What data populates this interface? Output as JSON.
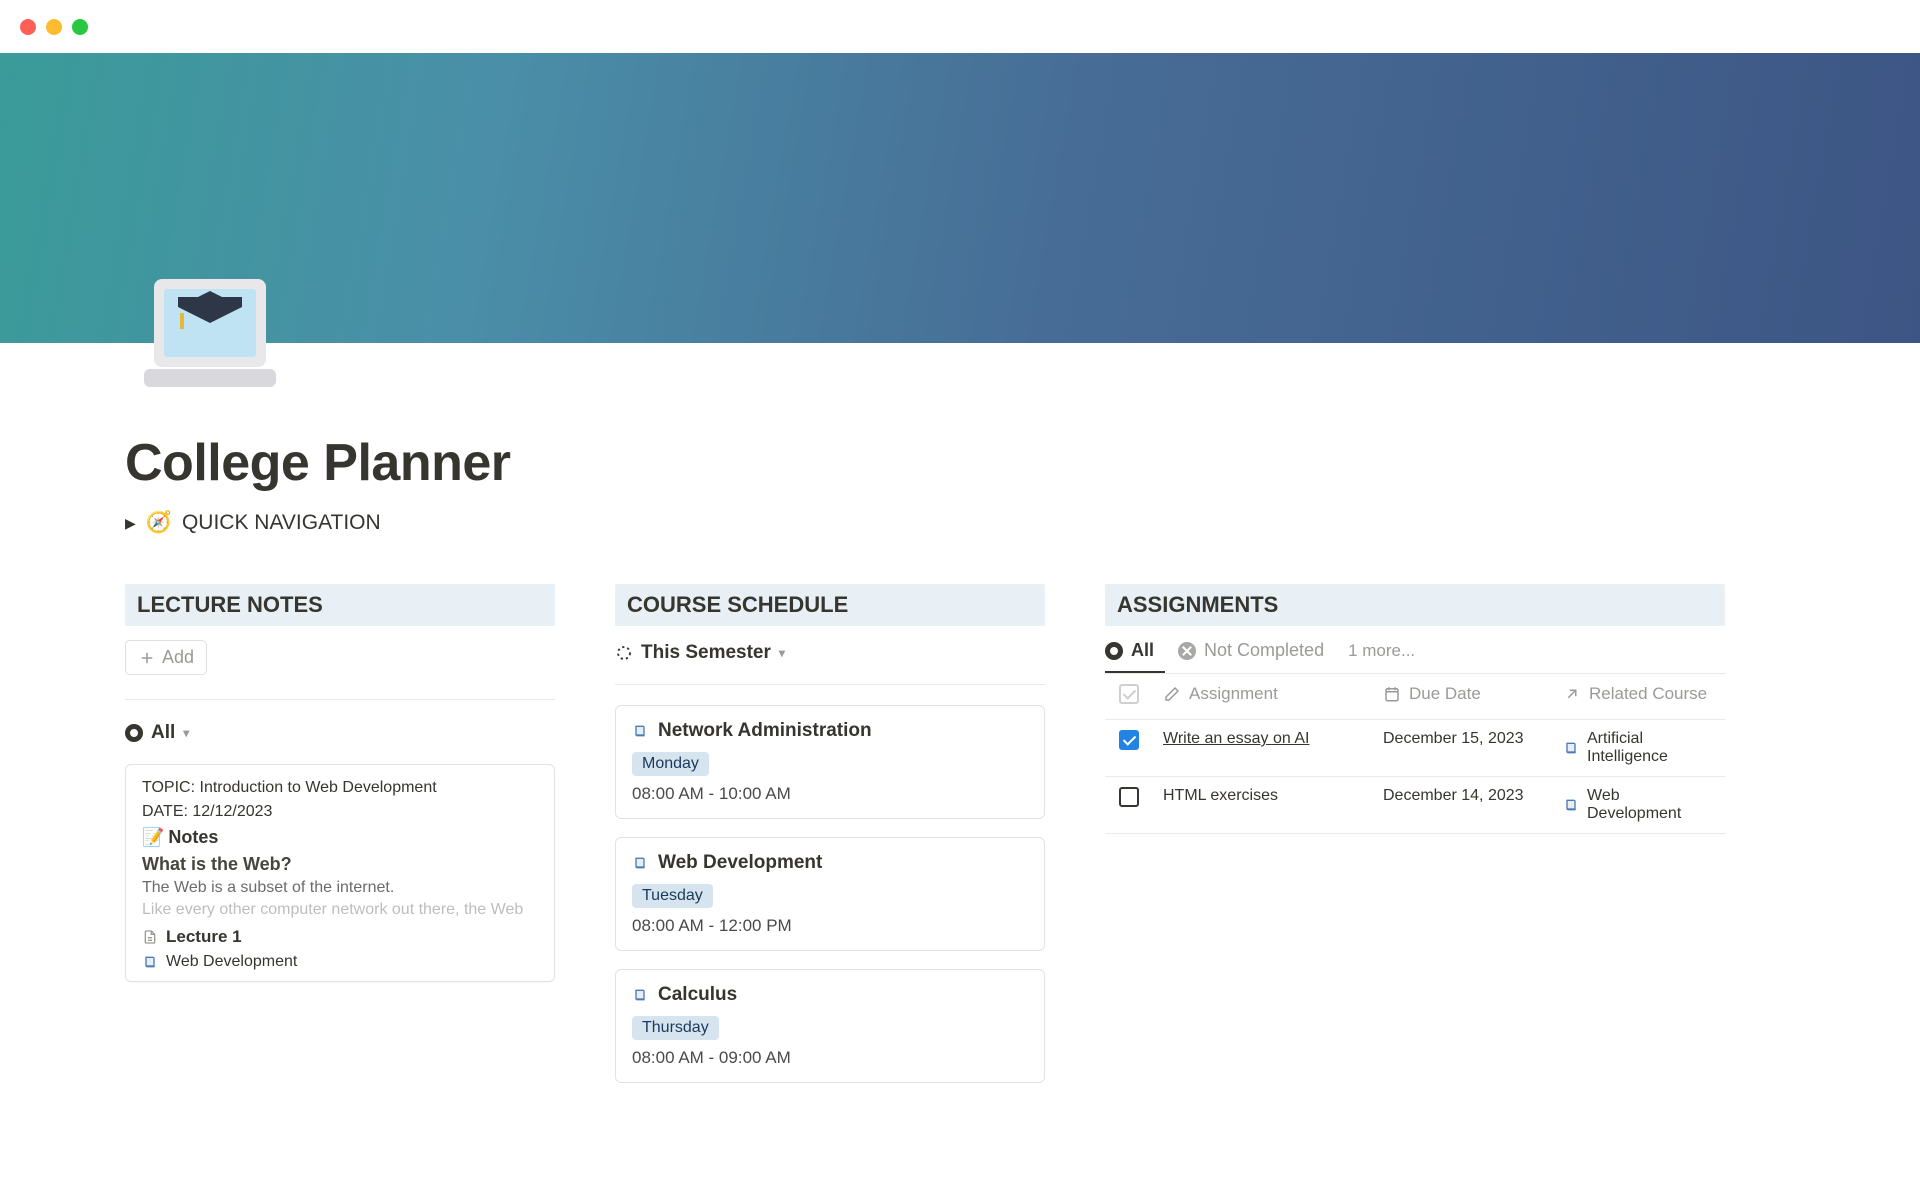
{
  "page": {
    "title": "College Planner"
  },
  "quicknav": {
    "icon": "🧭",
    "label": "QUICK NAVIGATION"
  },
  "sections": {
    "notes": "LECTURE NOTES",
    "schedule": "COURSE SCHEDULE",
    "assignments": "ASSIGNMENTS"
  },
  "notes": {
    "add": "Add",
    "view": "All",
    "card": {
      "topic": "TOPIC: Introduction to Web Development",
      "date": "DATE: 12/12/2023",
      "notes_hdr_icon": "📝",
      "notes_hdr": "Notes",
      "q": "What is the Web?",
      "l1": "The Web is a subset of the internet.",
      "l2": "Like every other computer network out there, the Web",
      "lecture": "Lecture 1",
      "tag": "Web Development"
    }
  },
  "schedule": {
    "view": "This Semester",
    "items": [
      {
        "title": "Network Administration",
        "day": "Monday",
        "time": "08:00 AM - 10:00 AM"
      },
      {
        "title": "Web Development",
        "day": "Tuesday",
        "time": "08:00 AM - 12:00 PM"
      },
      {
        "title": "Calculus",
        "day": "Thursday",
        "time": "08:00 AM - 09:00 AM"
      }
    ]
  },
  "assignments": {
    "tabs": {
      "all": "All",
      "nc": "Not Completed",
      "more": "1 more..."
    },
    "headers": {
      "assignment": "Assignment",
      "due": "Due Date",
      "related": "Related Course"
    },
    "rows": [
      {
        "done": true,
        "title": "Write an essay on AI",
        "due": "December 15, 2023",
        "course": "Artificial Intelligence"
      },
      {
        "done": false,
        "title": "HTML exercises",
        "due": "December 14, 2023",
        "course": "Web Development"
      }
    ]
  }
}
